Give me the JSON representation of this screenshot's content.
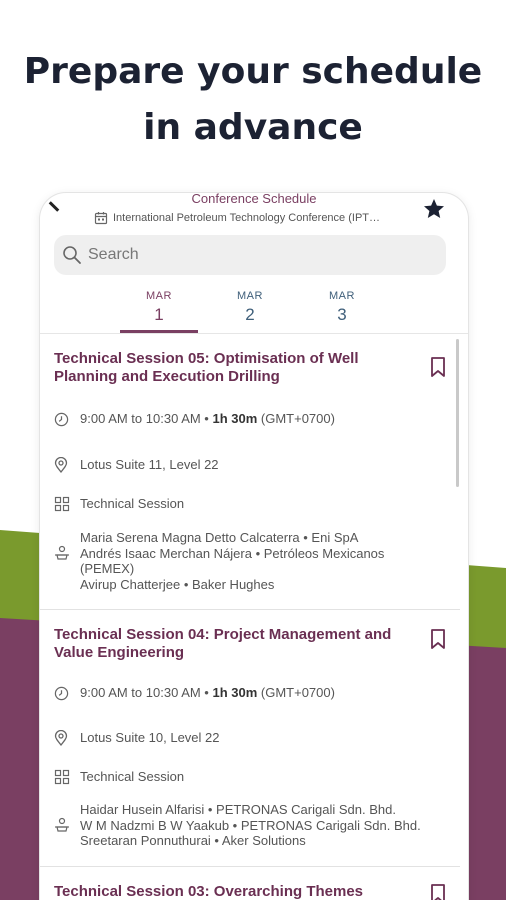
{
  "headline": {
    "line1": "Prepare your schedule",
    "line2": "in advance"
  },
  "topbar": {
    "title": "Conference Schedule",
    "subtitle": "International Petroleum Technology Conference (IPT…"
  },
  "search": {
    "placeholder": "Search"
  },
  "dates": [
    {
      "month": "MAR",
      "day": "1",
      "active": true
    },
    {
      "month": "MAR",
      "day": "2",
      "active": false
    },
    {
      "month": "MAR",
      "day": "3",
      "active": false
    }
  ],
  "sessions": [
    {
      "title": "Technical Session 05: Optimisation of Well Planning and Execution Drilling",
      "time_range": "9:00 AM to 10:30 AM • ",
      "duration": "1h 30m",
      "timezone": " (GMT+0700)",
      "location": "Lotus Suite 11, Level 22",
      "type": "Technical Session",
      "speakers": [
        "Maria Serena Magna Detto Calcaterra • Eni SpA",
        "Andrés Isaac Merchan Nájera • Petróleos Mexicanos (PEMEX)",
        "Avirup Chatterjee • Baker Hughes"
      ]
    },
    {
      "title": "Technical Session 04: Project Management and Value Engineering",
      "time_range": "9:00 AM to 10:30 AM • ",
      "duration": "1h 30m",
      "timezone": " (GMT+0700)",
      "location": "Lotus Suite 10, Level 22",
      "type": "Technical Session",
      "speakers": [
        "Haidar Husein Alfarisi • PETRONAS Carigali Sdn. Bhd.",
        "W M Nadzmi B W Yaakub • PETRONAS Carigali Sdn. Bhd.",
        "Sreetaran Ponnuthurai • Aker Solutions"
      ]
    },
    {
      "title": "Technical Session 03: Overarching Themes"
    }
  ],
  "colors": {
    "brand_purple": "#7a3f62",
    "brand_green": "#7a9a2d",
    "date_blue": "#3f5f7a",
    "headline": "#1c2233"
  },
  "icons": {
    "back": "back-arrow-icon",
    "star": "star-icon",
    "calendar": "calendar-icon",
    "search": "search-icon",
    "clock": "clock-icon",
    "location": "location-pin-icon",
    "type": "grid-icon",
    "speakers": "speaker-icon",
    "bookmark": "bookmark-icon"
  }
}
